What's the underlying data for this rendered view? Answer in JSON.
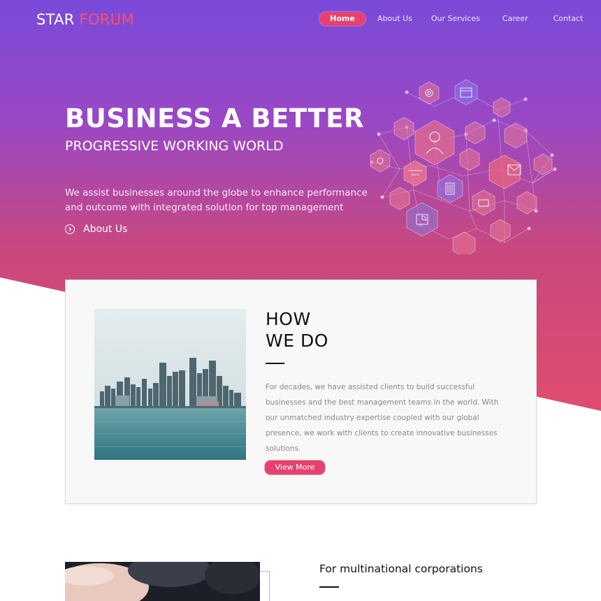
{
  "brand": {
    "part1": "STAR",
    "part2": "FORUM"
  },
  "nav": {
    "items": [
      {
        "label": "Home",
        "active": true
      },
      {
        "label": "About Us",
        "active": false
      },
      {
        "label": "Our Services",
        "active": false
      },
      {
        "label": "Career",
        "active": false
      },
      {
        "label": "Contact",
        "active": false
      }
    ]
  },
  "hero": {
    "title": "BUSINESS A BETTER",
    "subtitle": "PROGRESSIVE WORKING WORLD",
    "description": "We assist businesses around the globe to enhance performance and outcome with integrated solution for top management",
    "link_label": "About Us",
    "link_icon": "chevron-right-circle-icon",
    "illustration": "business-network-hexagon-icons"
  },
  "how": {
    "title_line1": "HOW",
    "title_line2": "WE DO",
    "body": "For decades, we have assisted clients to build successful businesses and the best management teams in the world. With our unmatched industry expertise coupled with our global presence, we work with clients to create innovative businesses solutions.",
    "button_label": "View More",
    "image": "city-skyline-over-water"
  },
  "section2": {
    "heading": "For multinational corporations",
    "image": "business-meeting-photo"
  },
  "colors": {
    "accent": "#e5426f",
    "gradient_top": "#7a4ad9",
    "gradient_bottom": "#e14c6e",
    "logo_accent": "#ff4f6a"
  }
}
